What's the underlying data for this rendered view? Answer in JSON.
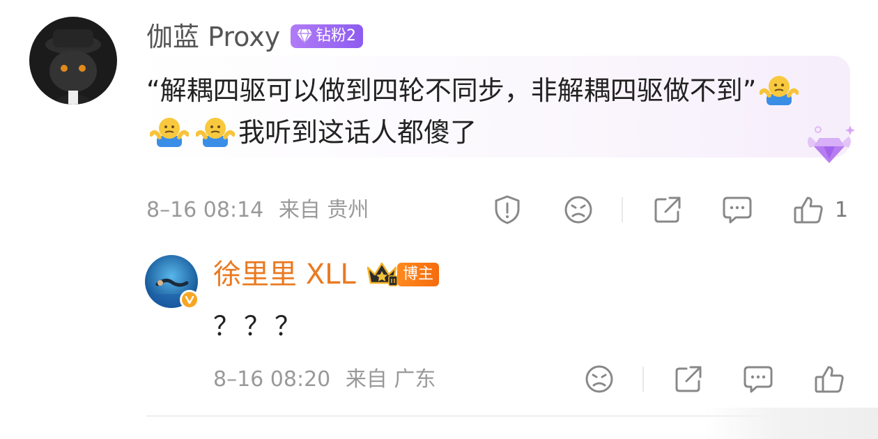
{
  "comment": {
    "author": "伽蓝 Proxy",
    "fan_badge": "钻粉2",
    "text_part1": "“解耦四驱可以做到四轮不同步，非解耦四驱做不到”",
    "text_part2": "我听到这话人都傻了",
    "emojis": [
      "shrug-emoji",
      "shrug-emoji",
      "shrug-emoji"
    ],
    "time": "8–16 08:14",
    "location": "来自 贵州",
    "likes": "1",
    "actions": [
      "report-icon",
      "dislike-icon",
      "share-icon",
      "reply-icon",
      "like-icon"
    ]
  },
  "reply": {
    "author": "徐里里 XLL",
    "host_badge": "博主",
    "text": "？？？",
    "time": "8–16 08:20",
    "location": "来自 广东",
    "actions": [
      "dislike-icon",
      "share-icon",
      "reply-icon",
      "like-icon"
    ]
  },
  "colors": {
    "reply_name": "#ea7a21",
    "fan_badge": "#9d6cf3",
    "meta_text": "#999999"
  }
}
